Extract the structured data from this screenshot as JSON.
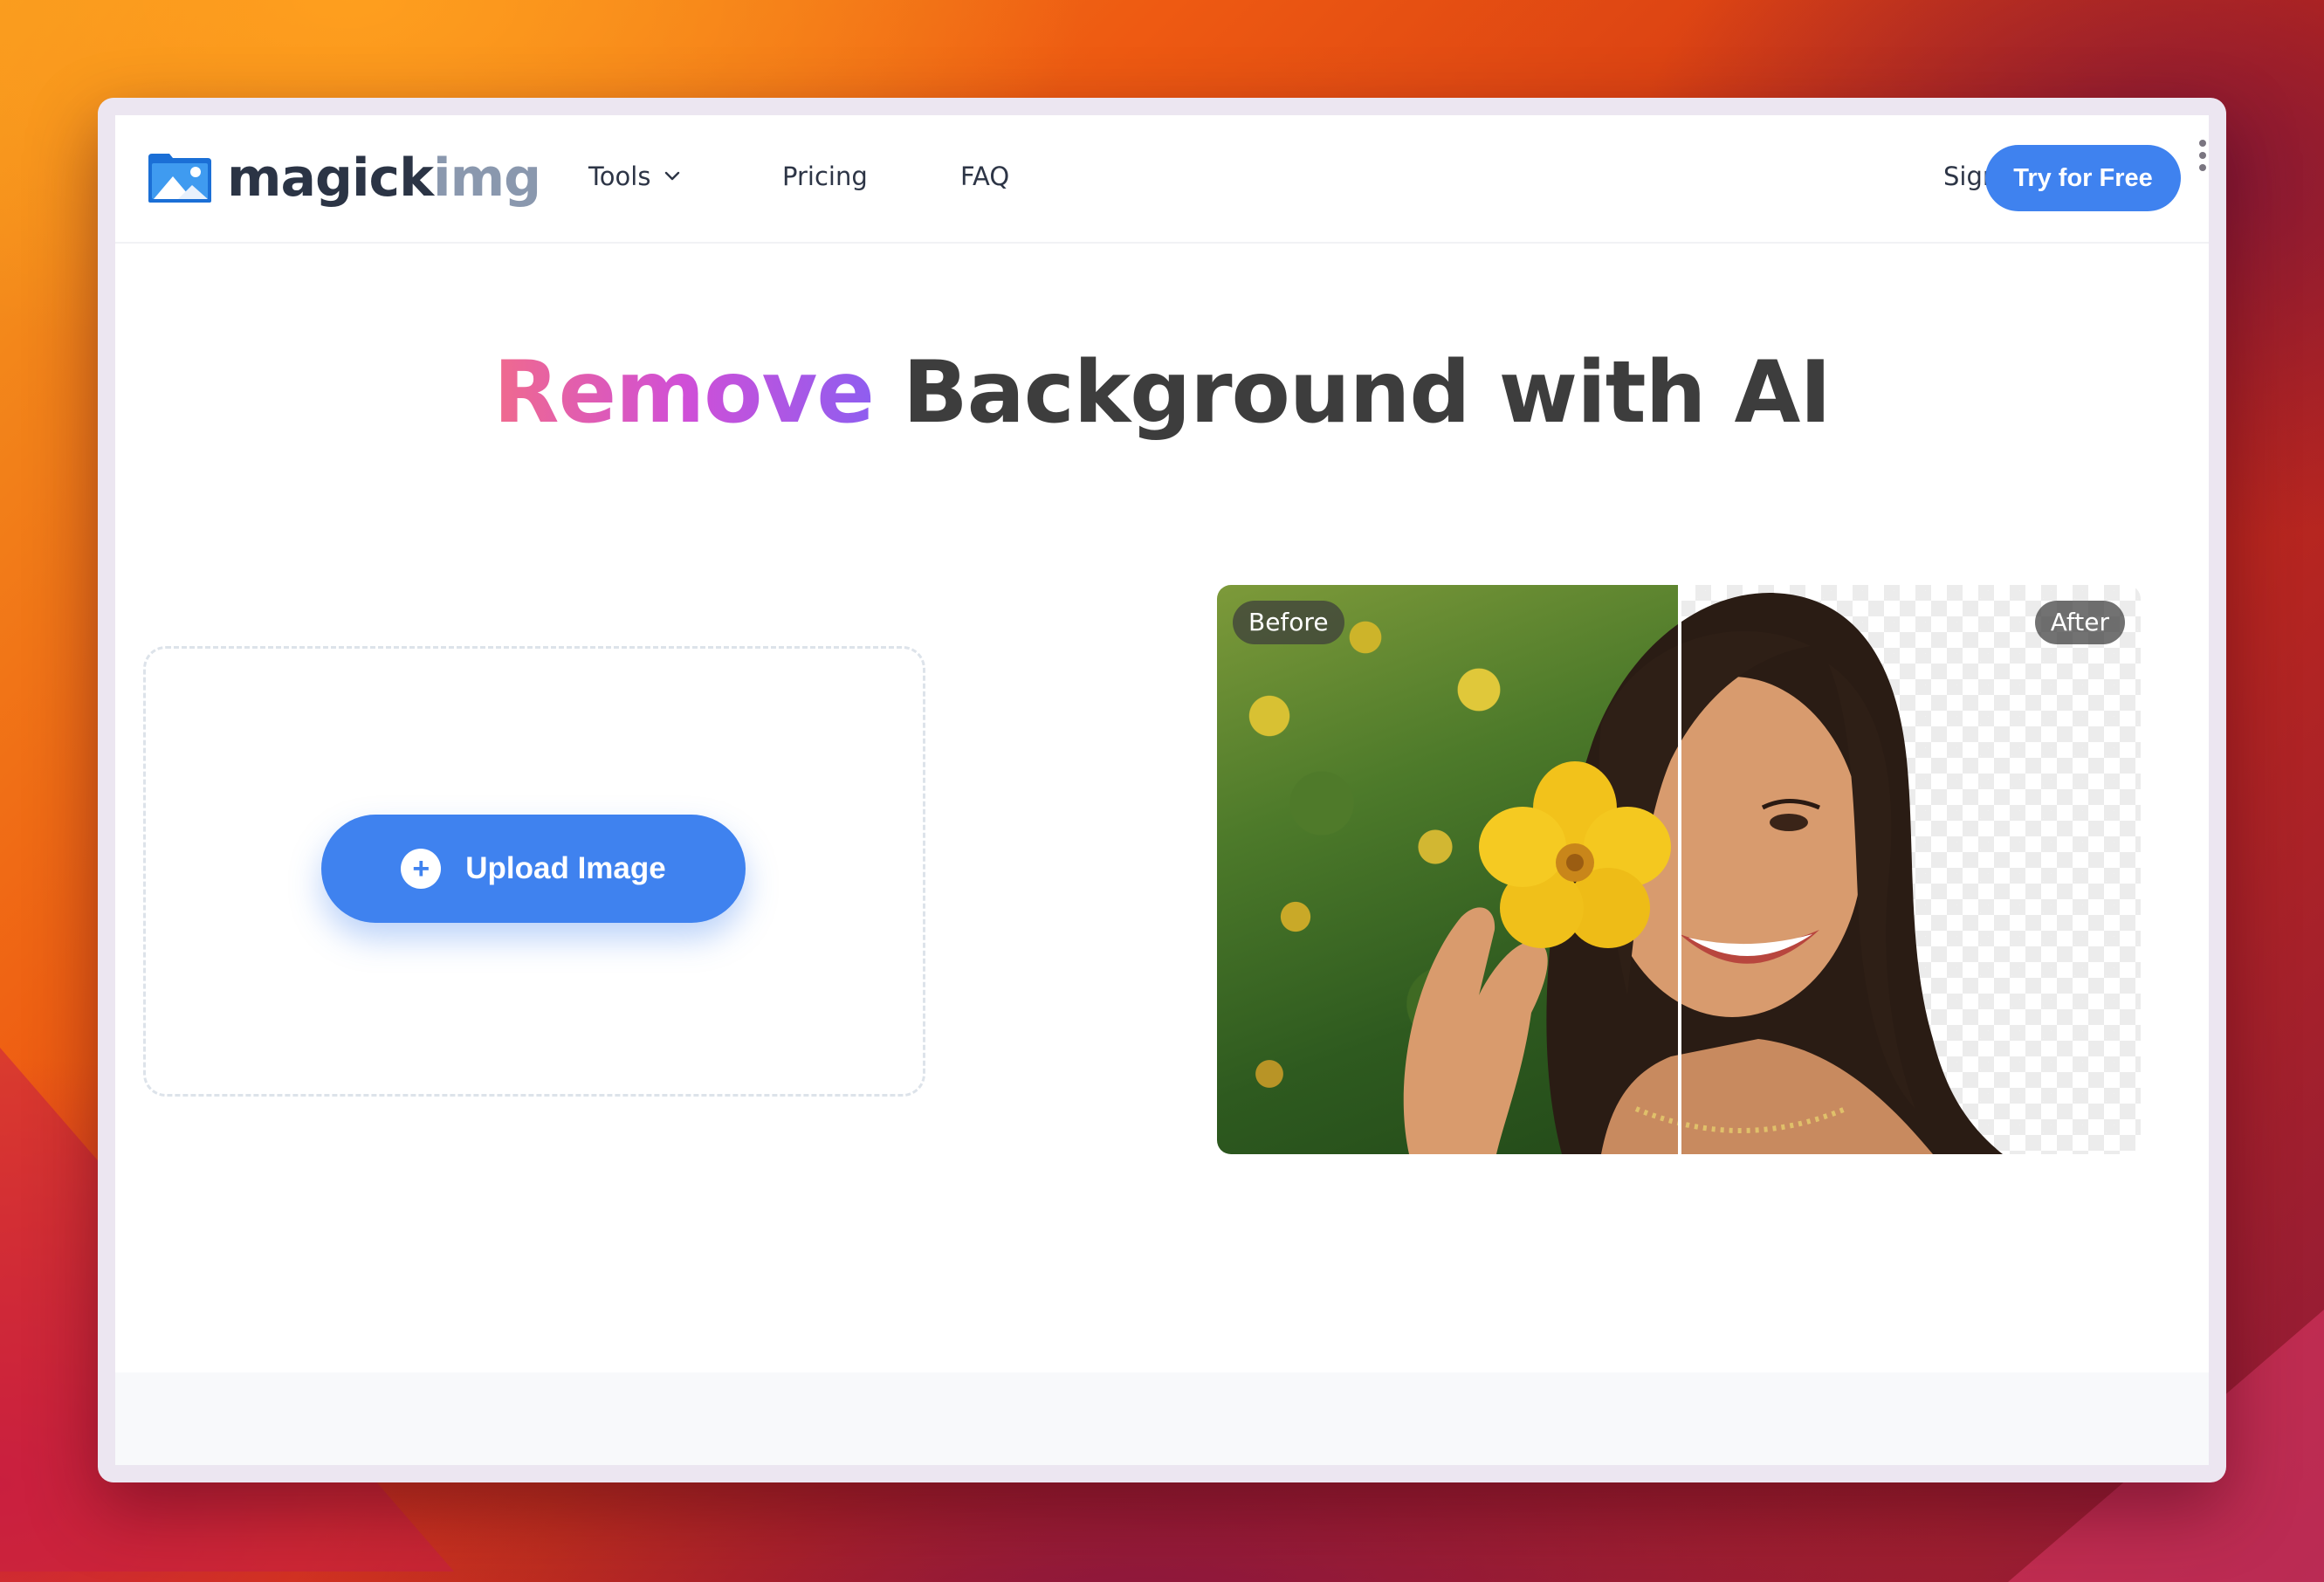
{
  "brand": {
    "name_part1": "magick",
    "name_part2": "img",
    "logo_icon": "image-landscape-icon",
    "accent_color": "#3f82ef"
  },
  "nav": {
    "items": [
      {
        "label": "Tools",
        "has_dropdown": true
      },
      {
        "label": "Pricing"
      },
      {
        "label": "FAQ"
      }
    ],
    "sign_in": "Sign in",
    "cta": "Try for Free"
  },
  "hero": {
    "title_highlight": "Remove",
    "title_rest": " Background with AI"
  },
  "upload": {
    "button_label": "Upload Image",
    "icon": "plus-circle-icon"
  },
  "compare": {
    "before_label": "Before",
    "after_label": "After"
  }
}
